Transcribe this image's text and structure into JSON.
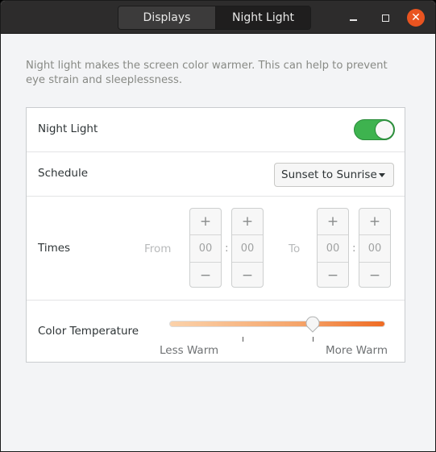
{
  "titlebar": {
    "tabs": [
      {
        "label": "Displays",
        "active": false
      },
      {
        "label": "Night Light",
        "active": true
      }
    ],
    "controls": {
      "minimize": "minimize-icon",
      "maximize": "maximize-icon",
      "close": "close-icon",
      "close_glyph": "✕",
      "close_color": "#e95420"
    }
  },
  "description": "Night light makes the screen color warmer. This can help to prevent eye strain and sleeplessness.",
  "settings": {
    "night_light": {
      "label": "Night Light",
      "enabled": true,
      "accent": "#3eb34f"
    },
    "schedule": {
      "label": "Schedule",
      "selected": "Sunset to Sunrise"
    },
    "times": {
      "label": "Times",
      "from_label": "From",
      "to_label": "To",
      "from_hours": "00",
      "from_minutes": "00",
      "to_hours": "00",
      "to_minutes": "00",
      "separator": ":",
      "plus": "+",
      "minus": "−"
    },
    "color_temperature": {
      "label": "Color Temperature",
      "value_fraction": 0.665,
      "tick_fraction": 0.34,
      "min_label": "Less Warm",
      "max_label": "More Warm"
    }
  }
}
